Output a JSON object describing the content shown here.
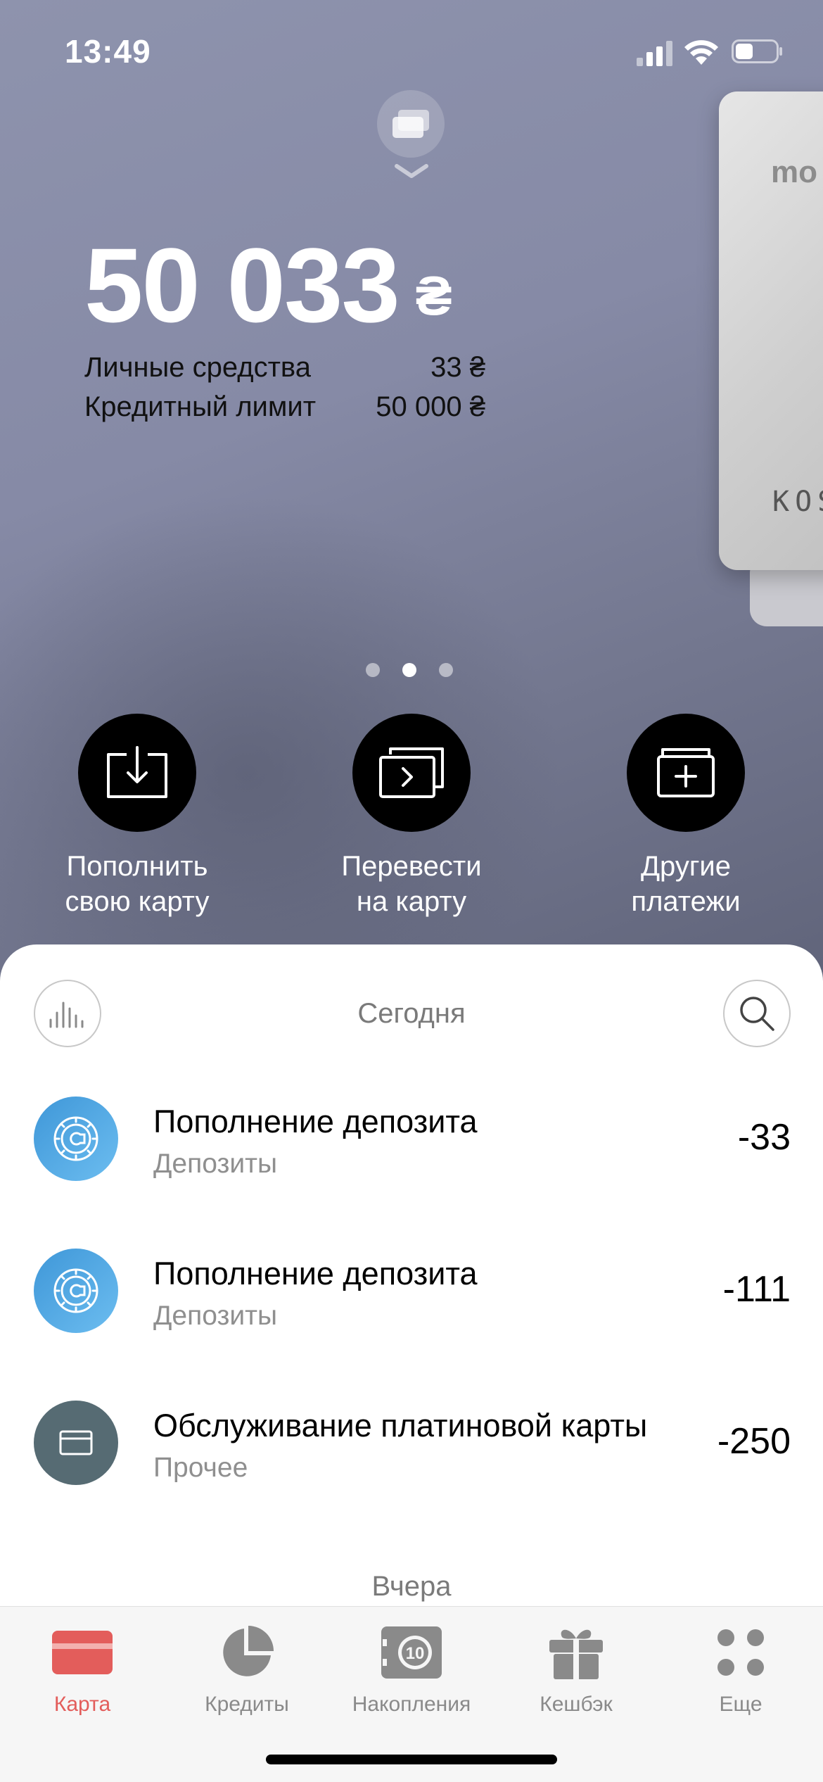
{
  "status_bar": {
    "time": "13:49"
  },
  "balance": {
    "amount": "50 033",
    "currency": "₴",
    "own_funds_label": "Личные средства",
    "own_funds_value": "33 ₴",
    "credit_limit_label": "Кредитный лимит",
    "credit_limit_value": "50 000 ₴"
  },
  "card": {
    "brand_partial": "mo",
    "holder_partial": "KOS"
  },
  "carousel": {
    "pages": 3,
    "active_index": 1
  },
  "actions": [
    {
      "label": "Пополнить\nсвою карту",
      "icon": "top-up-icon"
    },
    {
      "label": "Перевести\nна карту",
      "icon": "transfer-icon"
    },
    {
      "label": "Другие\nплатежи",
      "icon": "other-payments-icon"
    }
  ],
  "feed": {
    "today_label": "Сегодня",
    "yesterday_label": "Вчера",
    "transactions": [
      {
        "title": "Пополнение депозита",
        "category": "Депозиты",
        "amount": "-33",
        "icon": "deposit-icon",
        "icon_color": "#4aa3e0"
      },
      {
        "title": "Пополнение депозита",
        "category": "Депозиты",
        "amount": "-111",
        "icon": "deposit-icon",
        "icon_color": "#4aa3e0"
      },
      {
        "title": "Обслуживание платиновой карты",
        "category": "Прочее",
        "amount": "-250",
        "icon": "card-icon",
        "icon_color": "#566b73"
      }
    ]
  },
  "tabbar": {
    "tabs": [
      {
        "label": "Карта",
        "icon": "card-tab-icon",
        "active": true
      },
      {
        "label": "Кредиты",
        "icon": "pie-chart-icon",
        "active": false
      },
      {
        "label": "Накопления",
        "icon": "safe-icon",
        "active": false
      },
      {
        "label": "Кешбэк",
        "icon": "gift-icon",
        "active": false
      },
      {
        "label": "Еще",
        "icon": "more-dots-icon",
        "active": false
      }
    ],
    "active_color": "#e35d5b",
    "inactive_color": "#8a8a8a"
  }
}
